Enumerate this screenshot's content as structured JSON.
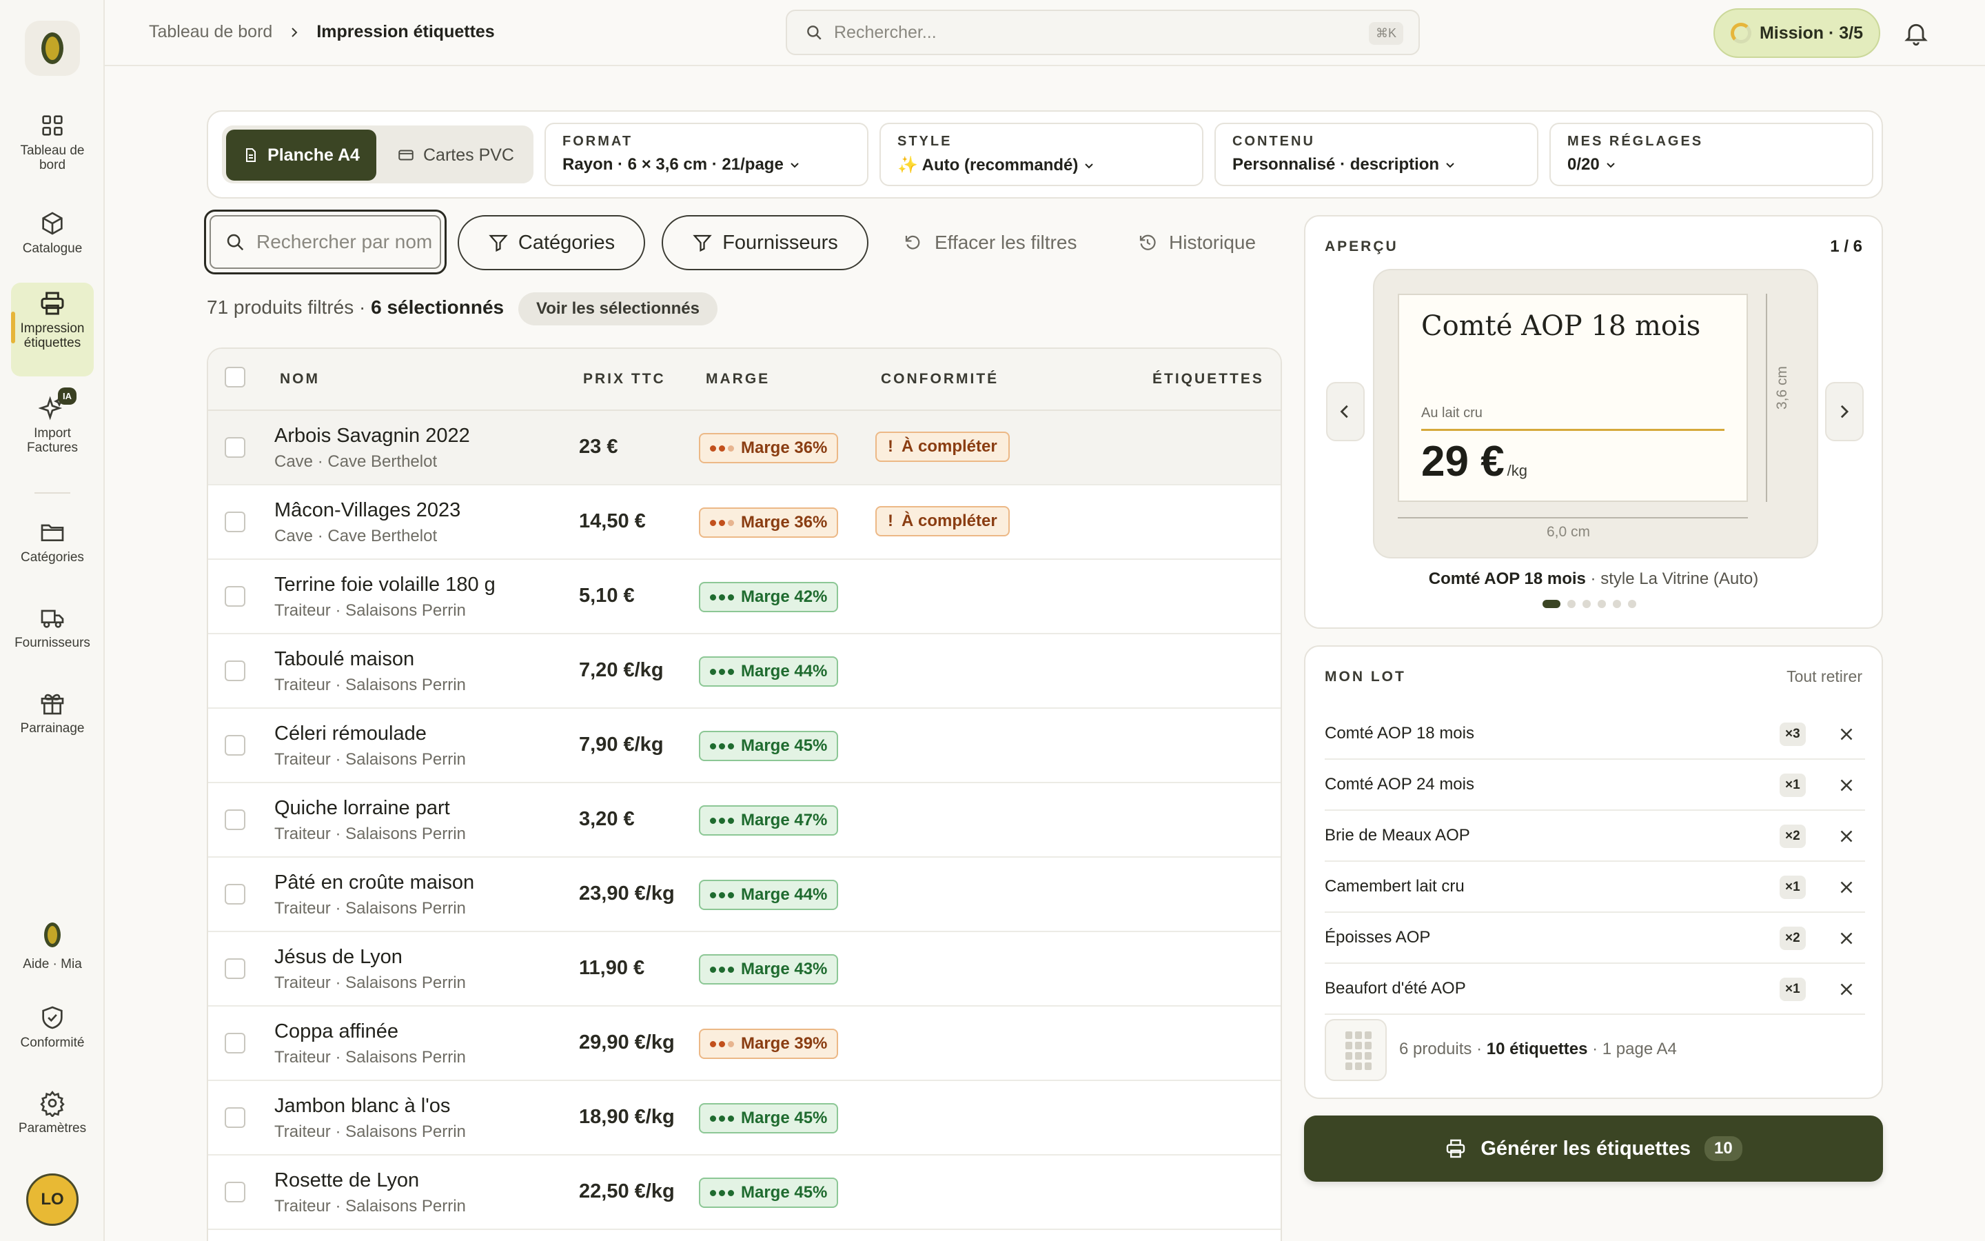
{
  "sidebar": {
    "items": [
      {
        "id": "dashboard",
        "label": "Tableau de bord",
        "icon": "grid-icon"
      },
      {
        "id": "catalogue",
        "label": "Catalogue",
        "icon": "box-icon"
      },
      {
        "id": "impression",
        "label": "Impression étiquettes",
        "icon": "printer-icon",
        "active": true
      },
      {
        "id": "import",
        "label": "Import Factures",
        "icon": "sparkle-icon",
        "badge": "IA"
      },
      {
        "id": "categories",
        "label": "Catégories",
        "icon": "folder-icon"
      },
      {
        "id": "fournisseurs",
        "label": "Fournisseurs",
        "icon": "truck-icon"
      },
      {
        "id": "parrainage",
        "label": "Parrainage",
        "icon": "gift-icon"
      },
      {
        "id": "aide",
        "label": "Aide · Mia",
        "icon": "olive-icon"
      },
      {
        "id": "conformite",
        "label": "Conformité",
        "icon": "shield-check-icon"
      },
      {
        "id": "parametres",
        "label": "Paramètres",
        "icon": "gear-icon"
      }
    ],
    "avatar": "LO"
  },
  "topbar": {
    "breadcrumb": [
      "Tableau de bord",
      "Impression étiquettes"
    ],
    "search_placeholder": "Rechercher...",
    "shortcut": "⌘K",
    "mission": "Mission · 3/5"
  },
  "toolbar": {
    "mode_active": "Planche A4",
    "mode_other": "Cartes PVC",
    "format": {
      "label": "FORMAT",
      "value": "Rayon · 6 × 3,6 cm · 21/page"
    },
    "style": {
      "label": "STYLE",
      "value": "✨ Auto (recommandé)"
    },
    "contenu": {
      "label": "CONTENU",
      "value": "Personnalisé · description"
    },
    "reglages": {
      "label": "MES RÉGLAGES",
      "value": "0/20"
    }
  },
  "filters": {
    "search_placeholder": "Rechercher par nom",
    "categories": "Catégories",
    "fournisseurs": "Fournisseurs",
    "effacer": "Effacer les filtres",
    "historique": "Historique",
    "count_text": "71 produits filtrés · ",
    "selected_text": "6 sélectionnés",
    "voir": "Voir les sélectionnés"
  },
  "table": {
    "headers": {
      "nom": "NOM",
      "prix": "PRIX TTC",
      "marge": "MARGE",
      "conformite": "CONFORMITÉ",
      "etiquettes": "ÉTIQUETTES"
    },
    "rows": [
      {
        "name": "Arbois Savagnin 2022",
        "sub": "Cave · Cave Berthelot",
        "price": "23 €",
        "margin": "Marge 36%",
        "tone": "o",
        "conf": "À compléter"
      },
      {
        "name": "Mâcon-Villages 2023",
        "sub": "Cave · Cave Berthelot",
        "price": "14,50 €",
        "margin": "Marge 36%",
        "tone": "o",
        "conf": "À compléter"
      },
      {
        "name": "Terrine foie volaille 180 g",
        "sub": "Traiteur · Salaisons Perrin",
        "price": "5,10 €",
        "margin": "Marge 42%",
        "tone": "g",
        "conf": ""
      },
      {
        "name": "Taboulé maison",
        "sub": "Traiteur · Salaisons Perrin",
        "price": "7,20 €/kg",
        "margin": "Marge 44%",
        "tone": "g",
        "conf": ""
      },
      {
        "name": "Céleri rémoulade",
        "sub": "Traiteur · Salaisons Perrin",
        "price": "7,90 €/kg",
        "margin": "Marge 45%",
        "tone": "g",
        "conf": ""
      },
      {
        "name": "Quiche lorraine part",
        "sub": "Traiteur · Salaisons Perrin",
        "price": "3,20 €",
        "margin": "Marge 47%",
        "tone": "g",
        "conf": ""
      },
      {
        "name": "Pâté en croûte maison",
        "sub": "Traiteur · Salaisons Perrin",
        "price": "23,90 €/kg",
        "margin": "Marge 44%",
        "tone": "g",
        "conf": ""
      },
      {
        "name": "Jésus de Lyon",
        "sub": "Traiteur · Salaisons Perrin",
        "price": "11,90 €",
        "margin": "Marge 43%",
        "tone": "g",
        "conf": ""
      },
      {
        "name": "Coppa affinée",
        "sub": "Traiteur · Salaisons Perrin",
        "price": "29,90 €/kg",
        "margin": "Marge 39%",
        "tone": "o",
        "conf": ""
      },
      {
        "name": "Jambon blanc à l'os",
        "sub": "Traiteur · Salaisons Perrin",
        "price": "18,90 €/kg",
        "margin": "Marge 45%",
        "tone": "g",
        "conf": ""
      },
      {
        "name": "Rosette de Lyon",
        "sub": "Traiteur · Salaisons Perrin",
        "price": "22,50 €/kg",
        "margin": "Marge 45%",
        "tone": "g",
        "conf": ""
      }
    ]
  },
  "preview": {
    "label": "APERÇU",
    "page": "1 / 6",
    "card_title": "Comté AOP 18 mois",
    "card_sub": "Au lait cru",
    "card_price": "29 €",
    "card_unit": "/kg",
    "dim_h": "6,0 cm",
    "dim_v": "3,6 cm",
    "caption_bold": "Comté AOP 18 mois",
    "caption_rest": " · style La Vitrine (Auto)"
  },
  "lot": {
    "label": "MON LOT",
    "clear": "Tout retirer",
    "items": [
      {
        "name": "Comté AOP 18 mois",
        "qty": "×3"
      },
      {
        "name": "Comté AOP 24 mois",
        "qty": "×1"
      },
      {
        "name": "Brie de Meaux AOP",
        "qty": "×2"
      },
      {
        "name": "Camembert lait cru",
        "qty": "×1"
      },
      {
        "name": "Époisses AOP",
        "qty": "×2"
      },
      {
        "name": "Beaufort d'été AOP",
        "qty": "×1"
      }
    ],
    "summary_a": "6 produits · ",
    "summary_b": "10 étiquettes",
    "summary_c": " · 1 page A4"
  },
  "generate": {
    "label": "Générer les étiquettes",
    "count": "10"
  },
  "colors": {
    "brand": "#3b4524",
    "accent": "#e6b53a",
    "good": "#1f6b2f",
    "warn": "#8a3d12"
  }
}
